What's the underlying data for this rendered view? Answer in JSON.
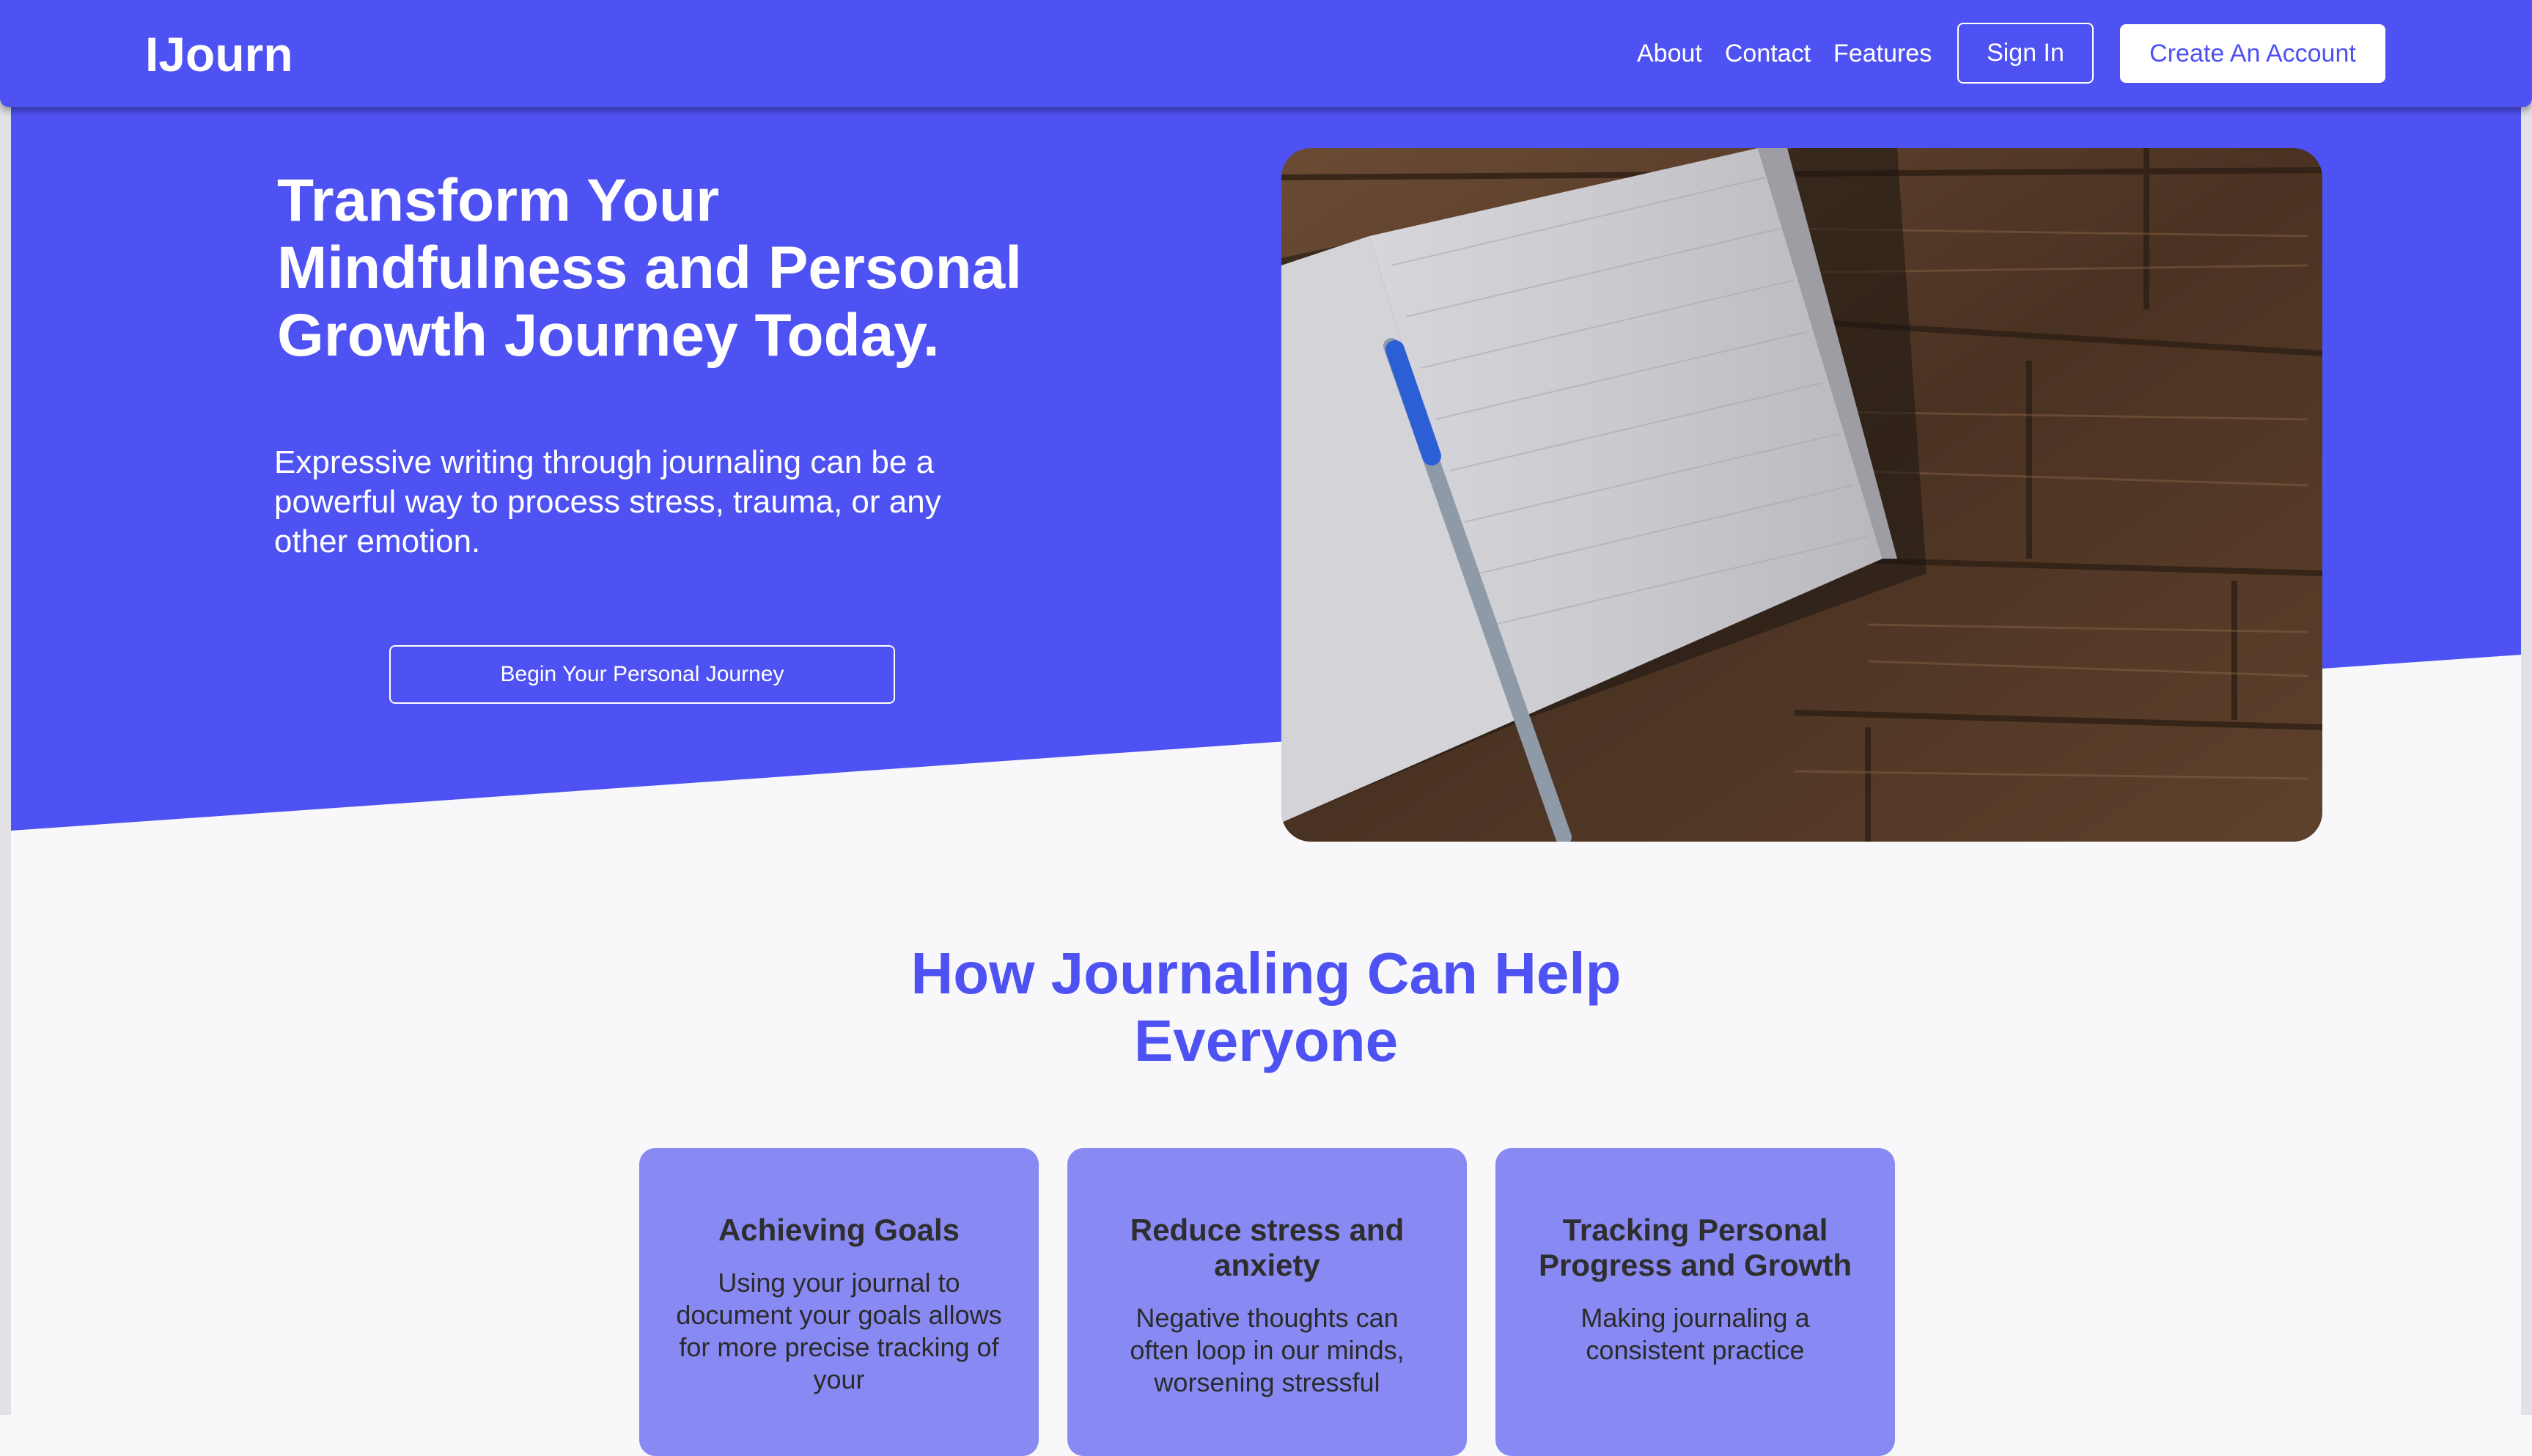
{
  "nav": {
    "brand": "IJourn",
    "links": [
      "About",
      "Contact",
      "Features"
    ],
    "sign_in": "Sign In",
    "create_account": "Create An Account"
  },
  "hero": {
    "title": "Transform Your Mindfulness and Personal Growth Journey Today.",
    "subtitle": "Expressive writing through journaling can be a powerful way to process stress, trauma, or any other emotion.",
    "cta": "Begin Your Personal Journey",
    "image": "notebook-with-pen-on-wooden-table"
  },
  "features": {
    "title": "How Journaling Can Help Everyone",
    "cards": [
      {
        "title": "Achieving Goals",
        "text": "Using your journal to document your goals allows for more precise tracking of your"
      },
      {
        "title": "Reduce stress and anxiety",
        "text": "Negative thoughts can often loop in our minds, worsening stressful"
      },
      {
        "title": "Tracking Personal Progress and Growth",
        "text": "Making journaling a consistent practice"
      }
    ]
  },
  "colors": {
    "primary": "#4f52f2",
    "card": "#8889f3",
    "background": "#f8f8fa"
  }
}
